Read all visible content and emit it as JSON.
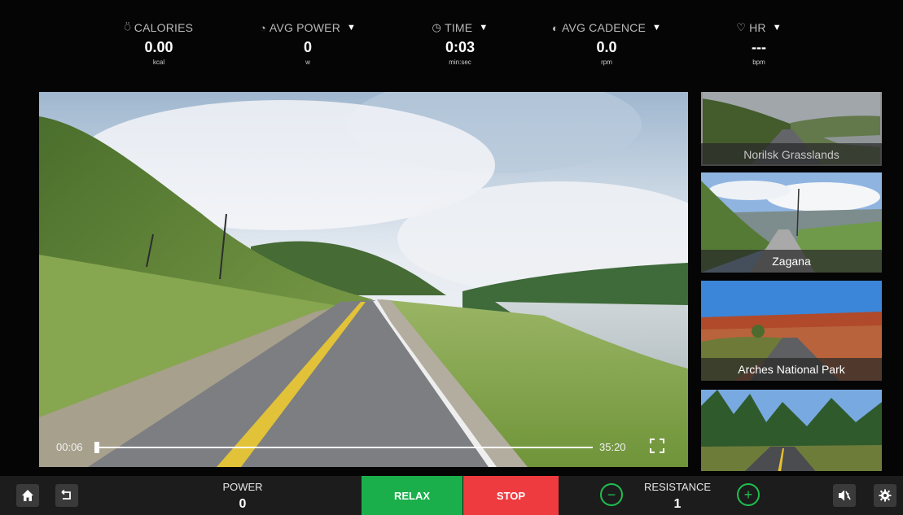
{
  "stats": [
    {
      "icon": "flame-icon",
      "glyph": "⍥",
      "label": "CALORIES",
      "dropdown": false,
      "value": "0.00",
      "unit": "kcal"
    },
    {
      "icon": "gauge-icon",
      "glyph": "◔",
      "label": "AVG POWER",
      "dropdown": true,
      "value": "0",
      "unit": "w"
    },
    {
      "icon": "clock-icon",
      "glyph": "◷",
      "label": "TIME",
      "dropdown": true,
      "value": "0:03",
      "unit": "min:sec"
    },
    {
      "icon": "cadence-icon",
      "glyph": "◐",
      "label": "AVG CADENCE",
      "dropdown": true,
      "value": "0.0",
      "unit": "rpm"
    },
    {
      "icon": "heart-icon",
      "glyph": "♡",
      "label": "HR",
      "dropdown": true,
      "value": "---",
      "unit": "bpm"
    }
  ],
  "video": {
    "elapsed": "00:06",
    "duration": "35:20",
    "progress_fraction": 0.003
  },
  "routes": [
    {
      "name": "Norilsk Grasslands",
      "active": true
    },
    {
      "name": "Zagana",
      "active": false
    },
    {
      "name": "Arches National Park",
      "active": false
    },
    {
      "name": "",
      "active": false
    }
  ],
  "controls": {
    "power_label": "POWER",
    "power_value": "0",
    "relax_label": "RELAX",
    "stop_label": "STOP",
    "resistance_label": "RESISTANCE",
    "resistance_value": "1",
    "minus": "−",
    "plus": "+"
  },
  "colors": {
    "relax": "#1aaf4b",
    "stop": "#ee3b3f",
    "accent_green": "#1fbf4f"
  }
}
